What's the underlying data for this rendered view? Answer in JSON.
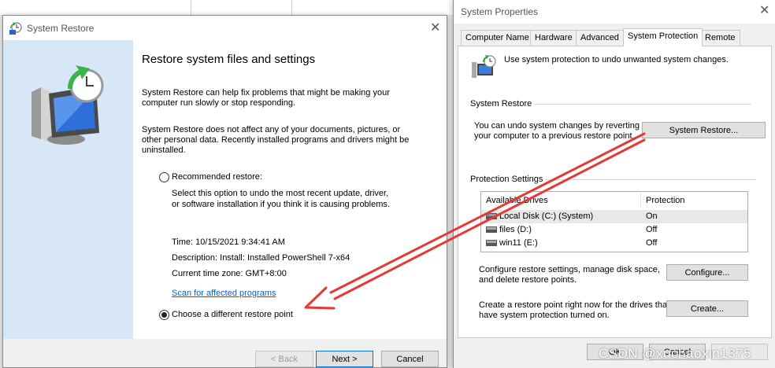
{
  "restore_wizard": {
    "title": "System Restore",
    "heading": "Restore system files and settings",
    "intro_line1": "System Restore can help fix problems that might be making your",
    "intro_line2": "computer run slowly or stop responding.",
    "note_line1": "System Restore does not affect any of your documents, pictures, or",
    "note_line2": "other personal data. Recently installed programs and drivers might be",
    "note_line3": "uninstalled.",
    "recommended_label": "Recommended restore:",
    "recommended_desc1": "Select this option to undo the most recent update, driver,",
    "recommended_desc2": "or software installation if you think it is causing problems.",
    "time": "Time: 10/15/2021 9:34:41 AM",
    "description": "Description: Install: Installed PowerShell 7-x64",
    "timezone": "Current time zone: GMT+8:00",
    "scan_link": "Scan for affected programs",
    "different_label": "Choose a different restore point",
    "selected_option": "Choose a different restore point",
    "back_button": "< Back",
    "next_button": "Next >",
    "cancel_button": "Cancel"
  },
  "system_properties": {
    "title": "System Properties",
    "tabs": [
      "Computer Name",
      "Hardware",
      "Advanced",
      "System Protection",
      "Remote"
    ],
    "active_tab": "System Protection",
    "protection_intro": "Use system protection to undo unwanted system changes.",
    "restore_group": "System Restore",
    "restore_desc1": "You can undo system changes by reverting",
    "restore_desc2": "your computer to a previous restore point.",
    "restore_button": "System Restore...",
    "settings_group": "Protection Settings",
    "drives_headers": {
      "drive": "Available Drives",
      "protection": "Protection"
    },
    "drives": [
      {
        "name": "Local Disk (C:) (System)",
        "protection": "On"
      },
      {
        "name": "files (D:)",
        "protection": "Off"
      },
      {
        "name": "win11 (E:)",
        "protection": "Off"
      }
    ],
    "configure_desc1": "Configure restore settings, manage disk space,",
    "configure_desc2": "and delete restore points.",
    "configure_button": "Configure...",
    "create_desc1": "Create a restore point right now for the drives that",
    "create_desc2": "have system protection turned on.",
    "create_button": "Create...",
    "ok_button": "OK",
    "cancel_button": "Cancel"
  },
  "watermark": "CSDN @xuchaoxin1375",
  "colors": {
    "arrow": "#e53935",
    "link": "#0a5fc4",
    "side_panel": "#d7e7f7",
    "default_button_border": "#0078d7"
  }
}
